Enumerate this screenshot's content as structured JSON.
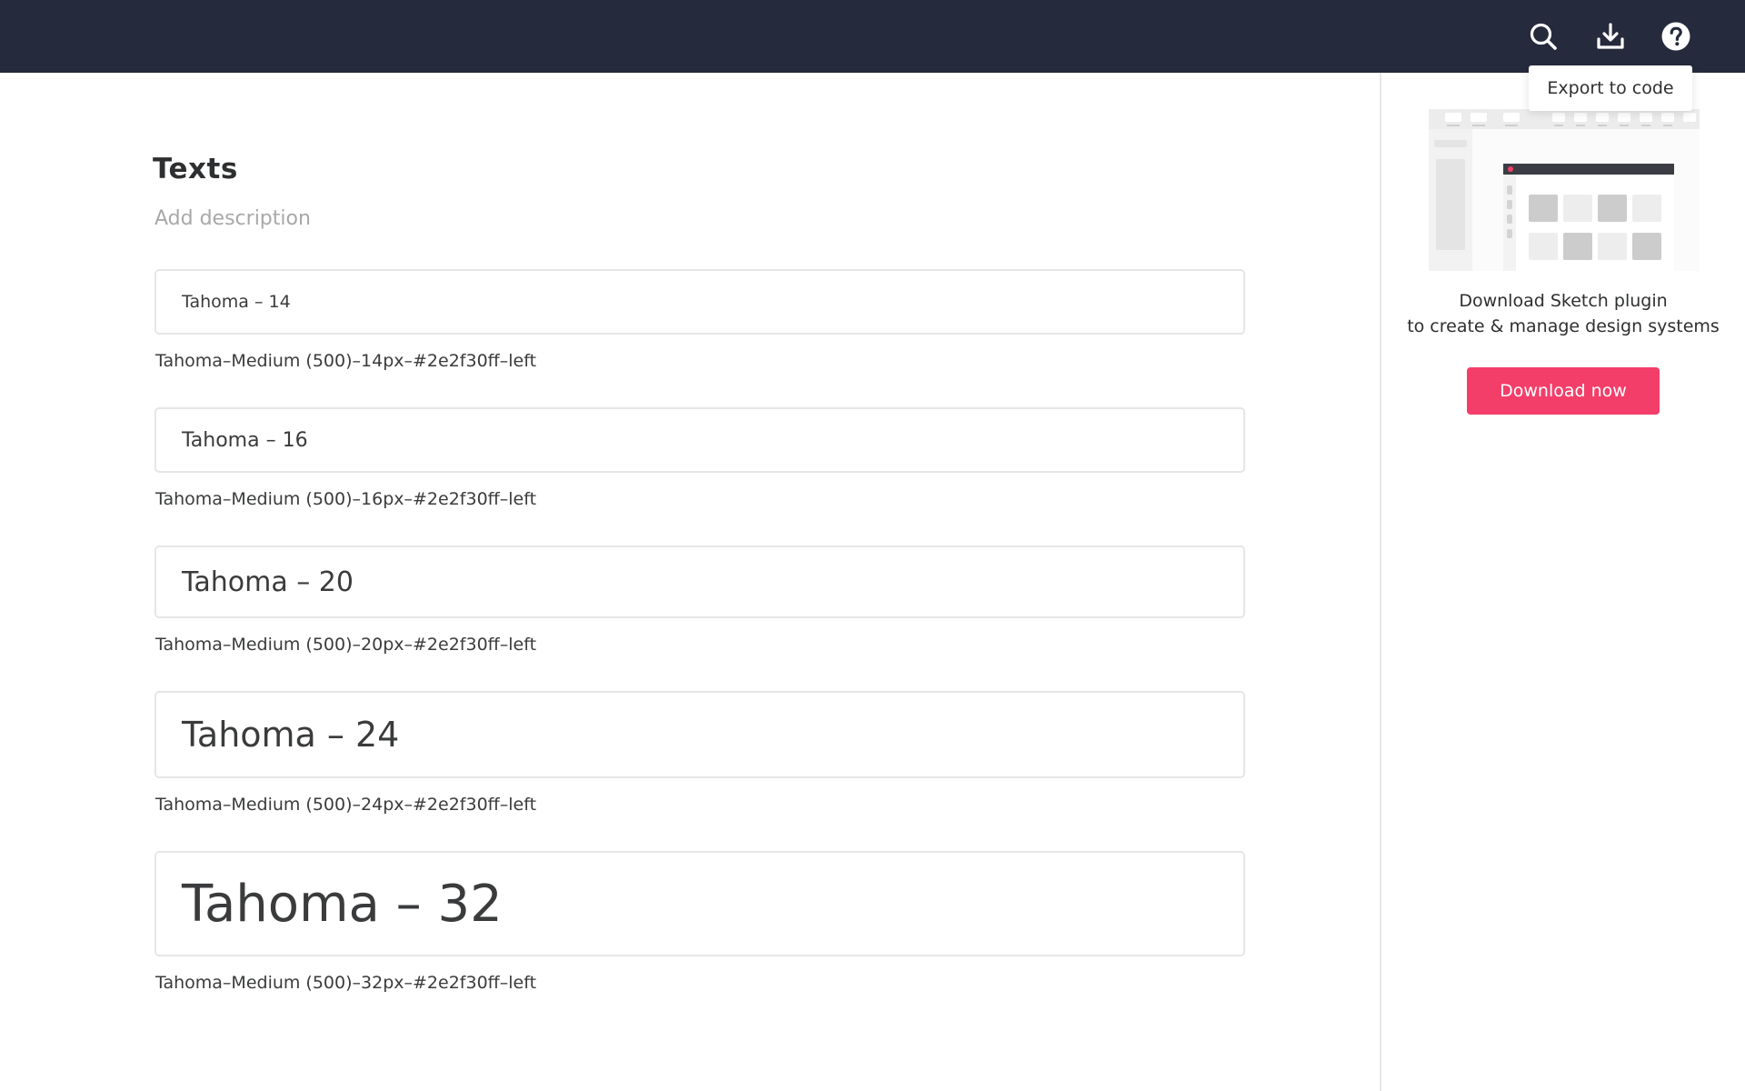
{
  "header": {
    "icons": [
      "search-icon",
      "export-icon",
      "help-icon"
    ],
    "tooltip": "Export to code",
    "background_color": "#252a3c"
  },
  "main": {
    "title": "Texts",
    "description_placeholder": "Add description",
    "text_styles": [
      {
        "sample": "Tahoma – 14",
        "meta": "Tahoma–Medium (500)–14px–#2e2f30ff–left"
      },
      {
        "sample": "Tahoma – 16",
        "meta": "Tahoma–Medium (500)–16px–#2e2f30ff–left"
      },
      {
        "sample": "Tahoma – 20",
        "meta": "Tahoma–Medium (500)–20px–#2e2f30ff–left"
      },
      {
        "sample": "Tahoma – 24",
        "meta": "Tahoma–Medium (500)–24px–#2e2f30ff–left"
      },
      {
        "sample": "Tahoma – 32",
        "meta": "Tahoma–Medium (500)–32px–#2e2f30ff–left"
      }
    ]
  },
  "sidebar": {
    "promo_line_1": "Download Sketch plugin",
    "promo_line_2": "to create & manage design systems",
    "download_button": "Download now",
    "accent_color": "#f43e6a"
  }
}
